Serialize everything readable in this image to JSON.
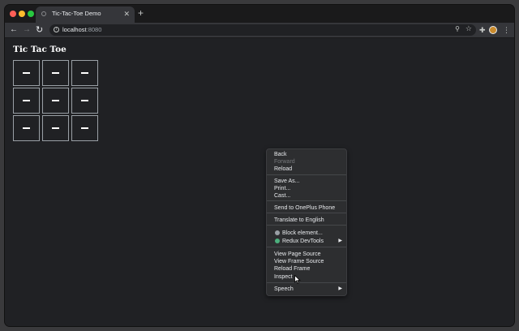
{
  "browser": {
    "tab_title": "Tic-Tac-Toe Demo",
    "tab_close": "✕",
    "new_tab": "+",
    "nav": {
      "back": "←",
      "forward": "→",
      "reload": "↻"
    },
    "url_host": "localhost",
    "url_port": ":8080",
    "toolbar_icons": {
      "zoom": "⚲",
      "star": "☆",
      "extensions": "✚",
      "menu": "⋮"
    }
  },
  "page": {
    "heading": "Tic Tac Toe",
    "cells": [
      "",
      "",
      "",
      "",
      "",
      "",
      "",
      "",
      ""
    ]
  },
  "context_menu": {
    "items": [
      {
        "label": "Back",
        "disabled": false
      },
      {
        "label": "Forward",
        "disabled": true
      },
      {
        "label": "Reload",
        "disabled": false
      },
      {
        "label": "Save As...",
        "disabled": false
      },
      {
        "label": "Print...",
        "disabled": false
      },
      {
        "label": "Cast...",
        "disabled": false
      },
      {
        "label": "Send to OnePlus Phone",
        "disabled": false
      },
      {
        "label": "Translate to English",
        "disabled": false
      },
      {
        "label": "Block element...",
        "disabled": false,
        "icon": "block-element-icon"
      },
      {
        "label": "Redux DevTools",
        "disabled": false,
        "icon": "redux-devtools-icon",
        "submenu": true
      },
      {
        "label": "View Page Source",
        "disabled": false
      },
      {
        "label": "View Frame Source",
        "disabled": false
      },
      {
        "label": "Reload Frame",
        "disabled": false
      },
      {
        "label": "Inspect",
        "disabled": false
      },
      {
        "label": "Speech",
        "disabled": false,
        "submenu": true
      }
    ],
    "submenu_arrow": "▶"
  },
  "colors": {
    "page_bg": "#202124",
    "toolbar_bg": "#35363a",
    "menu_bg": "#2d2e30",
    "text": "#e8eaed",
    "disabled_text": "#76787b"
  }
}
